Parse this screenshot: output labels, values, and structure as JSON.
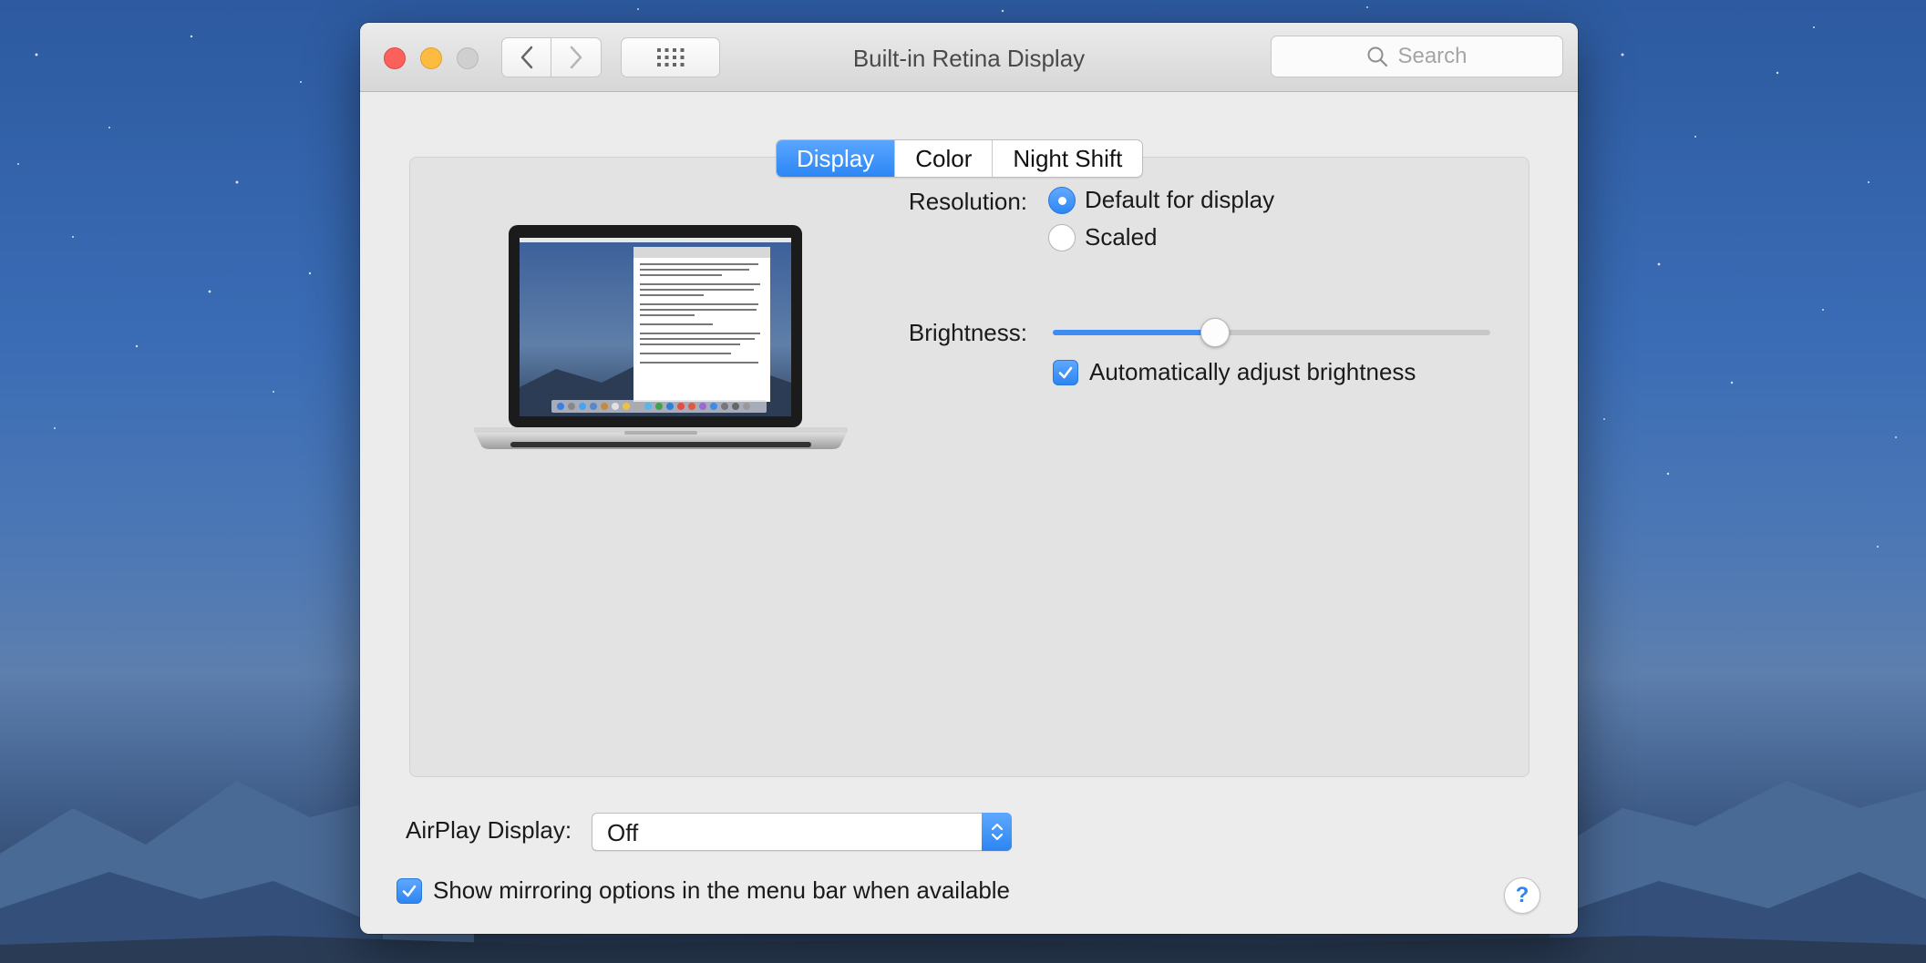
{
  "window": {
    "title": "Built-in Retina Display",
    "search_placeholder": "Search"
  },
  "tabs": [
    {
      "label": "Display",
      "active": true
    },
    {
      "label": "Color",
      "active": false
    },
    {
      "label": "Night Shift",
      "active": false
    }
  ],
  "resolution": {
    "label": "Resolution:",
    "options": [
      {
        "label": "Default for display",
        "selected": true
      },
      {
        "label": "Scaled",
        "selected": false
      }
    ]
  },
  "brightness": {
    "label": "Brightness:",
    "level": 0.37,
    "auto_adjust_label": "Automatically adjust brightness",
    "auto_adjust_checked": true
  },
  "airplay": {
    "label": "AirPlay Display:",
    "value": "Off"
  },
  "mirroring": {
    "label": "Show mirroring options in the menu bar when available",
    "checked": true
  },
  "help": {
    "label": "?"
  },
  "colors": {
    "accent": "#2c86f5",
    "close": "#fc605c",
    "minimize": "#fdbc40",
    "zoom_disabled": "#cfcfcf"
  }
}
